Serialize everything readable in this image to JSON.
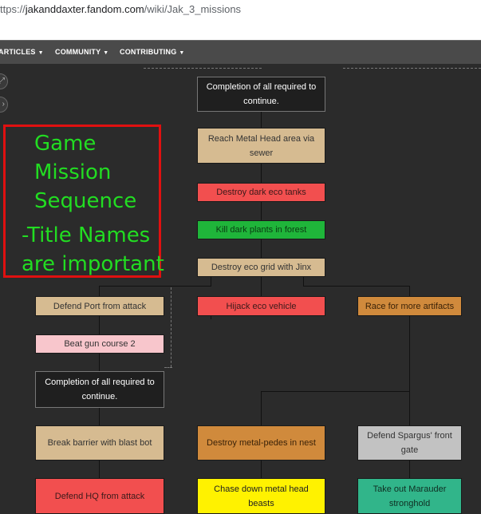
{
  "browser": {
    "url_prefix": "ttps://",
    "url_host": "jakanddaxter.fandom.com",
    "url_path": "/wiki/Jak_3_missions"
  },
  "nav": {
    "items": [
      "ARTICLES",
      "COMMUNITY",
      "CONTRIBUTING"
    ]
  },
  "annotation": {
    "lines": [
      "Game",
      "Mission",
      "Sequence",
      "-Title Names",
      "are important"
    ],
    "color": "#22dd22",
    "border_color": "#e01010"
  },
  "flowchart": {
    "completion_top": "Completion of all required to continue.",
    "reach_metal_head": "Reach Metal Head area via sewer",
    "destroy_dark_eco": "Destroy dark eco tanks",
    "kill_dark_plants": "Kill dark plants in forest",
    "destroy_eco_grid": "Destroy eco grid with Jinx",
    "defend_port": "Defend Port from attack",
    "hijack_eco": "Hijack eco vehicle",
    "race_artifacts": "Race for more artifacts",
    "beat_gun_course": "Beat gun course 2",
    "completion_mid": "Completion of all required to continue.",
    "break_barrier": "Break barrier with blast bot",
    "destroy_metal_pedes": "Destroy metal-pedes in nest",
    "defend_spargus": "Defend Spargus' front gate",
    "defend_hq": "Defend HQ from attack",
    "chase_metal_head": "Chase down metal head beasts",
    "take_out_marauder": "Take out Marauder stronghold"
  },
  "colors": {
    "tan": "#d6bb91",
    "red": "#f24f4f",
    "green": "#1fb53a",
    "pink": "#f8c6cc",
    "orange": "#d08a3c",
    "gray": "#c2c2c2",
    "yellow": "#fff200",
    "teal": "#31b58a",
    "dark": "#1f1f1f"
  },
  "icons": [
    "expand-icon",
    "chevron-right-icon",
    "caret-down-icon"
  ]
}
